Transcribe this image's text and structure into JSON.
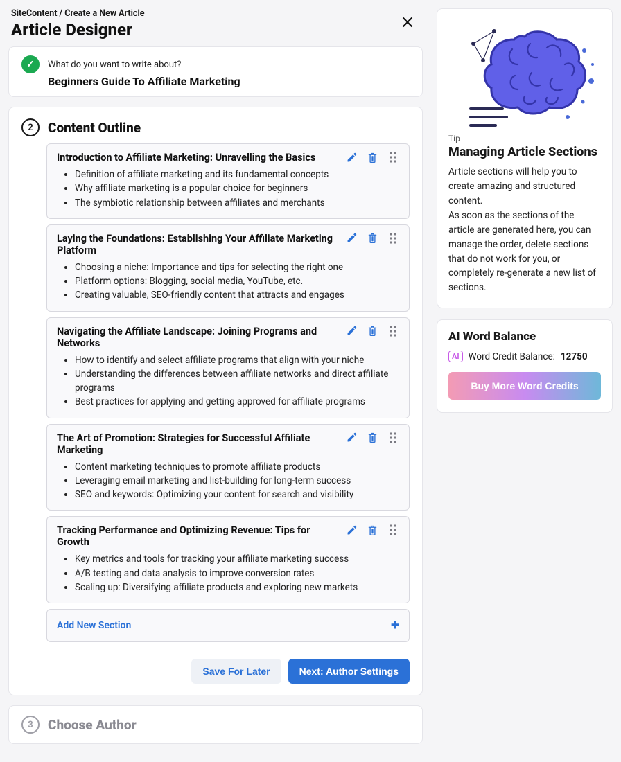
{
  "breadcrumb": "SiteContent / Create a New Article",
  "page_title": "Article Designer",
  "step1": {
    "label": "What do you want to write about?",
    "value": "Beginners Guide To Affiliate Marketing"
  },
  "step2": {
    "number": "2",
    "title": "Content Outline",
    "sections": [
      {
        "title": "Introduction to Affiliate Marketing: Unravelling the Basics",
        "points": [
          "Definition of affiliate marketing and its fundamental concepts",
          "Why affiliate marketing is a popular choice for beginners",
          "The symbiotic relationship between affiliates and merchants"
        ]
      },
      {
        "title": "Laying the Foundations: Establishing Your Affiliate Marketing Platform",
        "points": [
          "Choosing a niche: Importance and tips for selecting the right one",
          "Platform options: Blogging, social media, YouTube, etc.",
          "Creating valuable, SEO-friendly content that attracts and engages"
        ]
      },
      {
        "title": "Navigating the Affiliate Landscape: Joining Programs and Networks",
        "points": [
          "How to identify and select affiliate programs that align with your niche",
          "Understanding the differences between affiliate networks and direct affiliate programs",
          "Best practices for applying and getting approved for affiliate programs"
        ]
      },
      {
        "title": "The Art of Promotion: Strategies for Successful Affiliate Marketing",
        "points": [
          "Content marketing techniques to promote affiliate products",
          "Leveraging email marketing and list-building for long-term success",
          "SEO and keywords: Optimizing your content for search and visibility"
        ]
      },
      {
        "title": "Tracking Performance and Optimizing Revenue: Tips for Growth",
        "points": [
          "Key metrics and tools for tracking your affiliate marketing success",
          "A/B testing and data analysis to improve conversion rates",
          "Scaling up: Diversifying affiliate products and exploring new markets"
        ]
      }
    ],
    "add_label": "Add New Section"
  },
  "step3": {
    "number": "3",
    "title": "Choose Author"
  },
  "footer": {
    "save": "Save For Later",
    "next": "Next: Author Settings"
  },
  "tip": {
    "label": "Tip",
    "title": "Managing Article Sections",
    "body_line1": "Article sections will help you to create amazing and structured content.",
    "body_line2": "As soon as the sections of the article are generated here, you can manage the order, delete sections that do not work for you, or completely re-generate a new list of sections."
  },
  "balance": {
    "title": "AI Word Balance",
    "badge": "AI",
    "label": "Word Credit Balance:",
    "value": "12750",
    "buy": "Buy More Word Credits"
  }
}
